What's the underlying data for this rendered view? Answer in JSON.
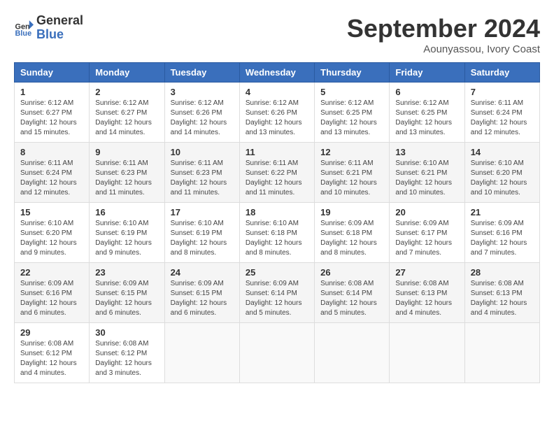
{
  "header": {
    "logo_line1": "General",
    "logo_line2": "Blue",
    "month": "September 2024",
    "location": "Aounyassou, Ivory Coast"
  },
  "columns": [
    "Sunday",
    "Monday",
    "Tuesday",
    "Wednesday",
    "Thursday",
    "Friday",
    "Saturday"
  ],
  "weeks": [
    [
      {
        "day": "1",
        "info": "Sunrise: 6:12 AM\nSunset: 6:27 PM\nDaylight: 12 hours\nand 15 minutes."
      },
      {
        "day": "2",
        "info": "Sunrise: 6:12 AM\nSunset: 6:27 PM\nDaylight: 12 hours\nand 14 minutes."
      },
      {
        "day": "3",
        "info": "Sunrise: 6:12 AM\nSunset: 6:26 PM\nDaylight: 12 hours\nand 14 minutes."
      },
      {
        "day": "4",
        "info": "Sunrise: 6:12 AM\nSunset: 6:26 PM\nDaylight: 12 hours\nand 13 minutes."
      },
      {
        "day": "5",
        "info": "Sunrise: 6:12 AM\nSunset: 6:25 PM\nDaylight: 12 hours\nand 13 minutes."
      },
      {
        "day": "6",
        "info": "Sunrise: 6:12 AM\nSunset: 6:25 PM\nDaylight: 12 hours\nand 13 minutes."
      },
      {
        "day": "7",
        "info": "Sunrise: 6:11 AM\nSunset: 6:24 PM\nDaylight: 12 hours\nand 12 minutes."
      }
    ],
    [
      {
        "day": "8",
        "info": "Sunrise: 6:11 AM\nSunset: 6:24 PM\nDaylight: 12 hours\nand 12 minutes."
      },
      {
        "day": "9",
        "info": "Sunrise: 6:11 AM\nSunset: 6:23 PM\nDaylight: 12 hours\nand 11 minutes."
      },
      {
        "day": "10",
        "info": "Sunrise: 6:11 AM\nSunset: 6:23 PM\nDaylight: 12 hours\nand 11 minutes."
      },
      {
        "day": "11",
        "info": "Sunrise: 6:11 AM\nSunset: 6:22 PM\nDaylight: 12 hours\nand 11 minutes."
      },
      {
        "day": "12",
        "info": "Sunrise: 6:11 AM\nSunset: 6:21 PM\nDaylight: 12 hours\nand 10 minutes."
      },
      {
        "day": "13",
        "info": "Sunrise: 6:10 AM\nSunset: 6:21 PM\nDaylight: 12 hours\nand 10 minutes."
      },
      {
        "day": "14",
        "info": "Sunrise: 6:10 AM\nSunset: 6:20 PM\nDaylight: 12 hours\nand 10 minutes."
      }
    ],
    [
      {
        "day": "15",
        "info": "Sunrise: 6:10 AM\nSunset: 6:20 PM\nDaylight: 12 hours\nand 9 minutes."
      },
      {
        "day": "16",
        "info": "Sunrise: 6:10 AM\nSunset: 6:19 PM\nDaylight: 12 hours\nand 9 minutes."
      },
      {
        "day": "17",
        "info": "Sunrise: 6:10 AM\nSunset: 6:19 PM\nDaylight: 12 hours\nand 8 minutes."
      },
      {
        "day": "18",
        "info": "Sunrise: 6:10 AM\nSunset: 6:18 PM\nDaylight: 12 hours\nand 8 minutes."
      },
      {
        "day": "19",
        "info": "Sunrise: 6:09 AM\nSunset: 6:18 PM\nDaylight: 12 hours\nand 8 minutes."
      },
      {
        "day": "20",
        "info": "Sunrise: 6:09 AM\nSunset: 6:17 PM\nDaylight: 12 hours\nand 7 minutes."
      },
      {
        "day": "21",
        "info": "Sunrise: 6:09 AM\nSunset: 6:16 PM\nDaylight: 12 hours\nand 7 minutes."
      }
    ],
    [
      {
        "day": "22",
        "info": "Sunrise: 6:09 AM\nSunset: 6:16 PM\nDaylight: 12 hours\nand 6 minutes."
      },
      {
        "day": "23",
        "info": "Sunrise: 6:09 AM\nSunset: 6:15 PM\nDaylight: 12 hours\nand 6 minutes."
      },
      {
        "day": "24",
        "info": "Sunrise: 6:09 AM\nSunset: 6:15 PM\nDaylight: 12 hours\nand 6 minutes."
      },
      {
        "day": "25",
        "info": "Sunrise: 6:09 AM\nSunset: 6:14 PM\nDaylight: 12 hours\nand 5 minutes."
      },
      {
        "day": "26",
        "info": "Sunrise: 6:08 AM\nSunset: 6:14 PM\nDaylight: 12 hours\nand 5 minutes."
      },
      {
        "day": "27",
        "info": "Sunrise: 6:08 AM\nSunset: 6:13 PM\nDaylight: 12 hours\nand 4 minutes."
      },
      {
        "day": "28",
        "info": "Sunrise: 6:08 AM\nSunset: 6:13 PM\nDaylight: 12 hours\nand 4 minutes."
      }
    ],
    [
      {
        "day": "29",
        "info": "Sunrise: 6:08 AM\nSunset: 6:12 PM\nDaylight: 12 hours\nand 4 minutes."
      },
      {
        "day": "30",
        "info": "Sunrise: 6:08 AM\nSunset: 6:12 PM\nDaylight: 12 hours\nand 3 minutes."
      },
      {
        "day": "",
        "info": ""
      },
      {
        "day": "",
        "info": ""
      },
      {
        "day": "",
        "info": ""
      },
      {
        "day": "",
        "info": ""
      },
      {
        "day": "",
        "info": ""
      }
    ]
  ]
}
